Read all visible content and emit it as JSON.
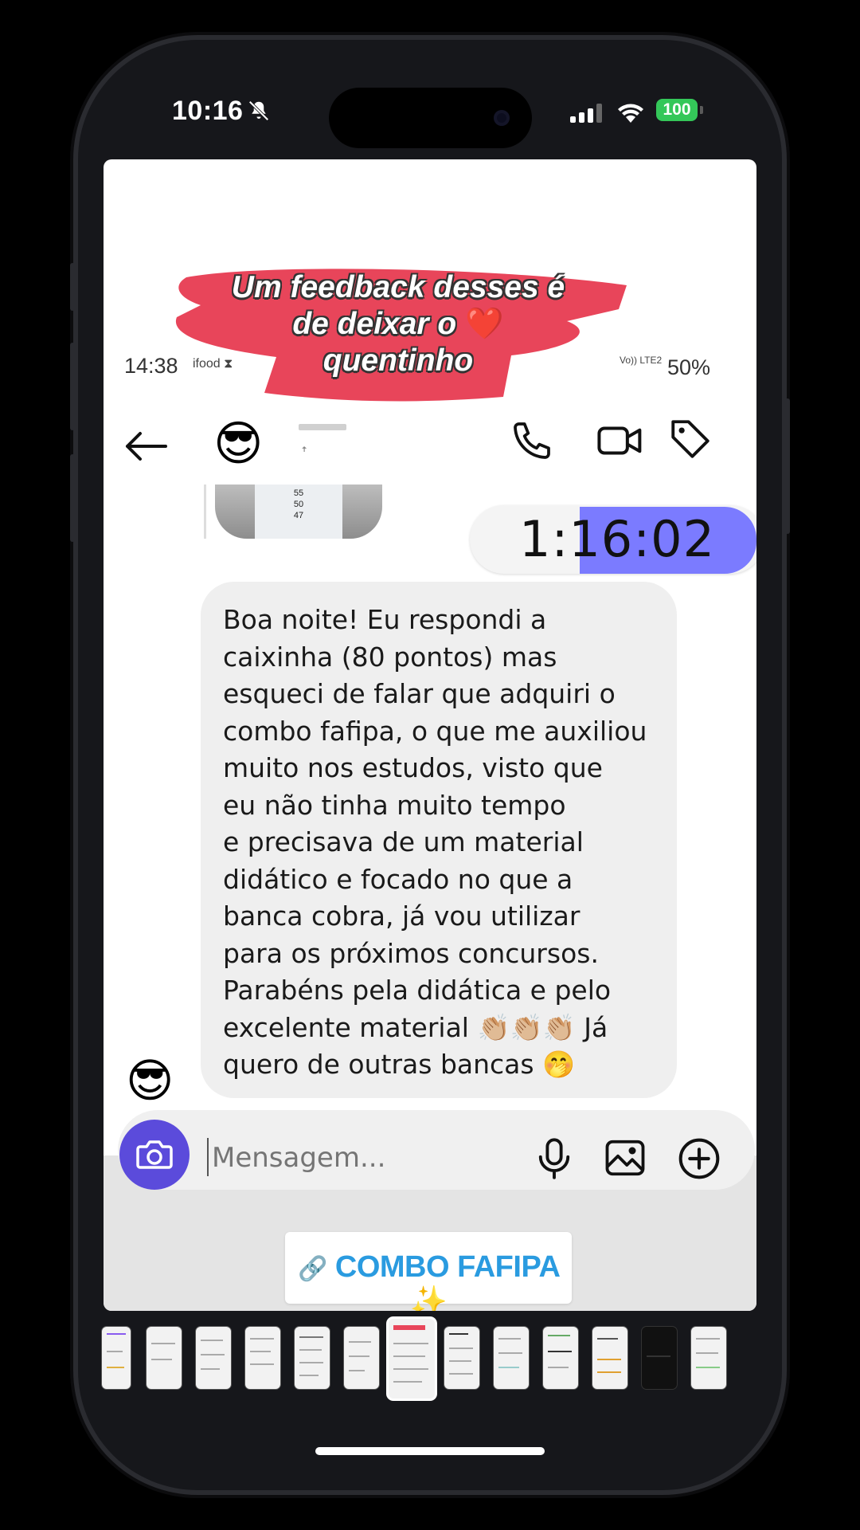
{
  "status_bar": {
    "time": "10:16",
    "battery": "100"
  },
  "story_overlay": {
    "banner_line1": "Um feedback desses é",
    "banner_line2": "de deixar o",
    "banner_heart": "❤️",
    "banner_line3": "quentinho"
  },
  "inner_status_bar": {
    "time": "14:38",
    "signal_text": "Vo)) LTE2",
    "battery": "50%"
  },
  "chat": {
    "header": {
      "contact_avatar": "😎",
      "contact_sub": "ꜛ"
    },
    "timer": "1:16:02",
    "message": "Boa noite! Eu respondi a\ncaixinha (80 pontos) mas\nesqueci de falar que adquiri o\ncombo fafipa, o que me auxiliou\nmuito nos estudos, visto que\neu não tinha muito tempo\ne precisava de um material\ndidático e focado no que a\nbanca cobra, já vou utilizar\npara os próximos concursos.\nParabéns pela didática e pelo\nexcelente material 👏🏼👏🏼👏🏼 Já\nquero de outras bancas 🤭",
    "sender_avatar": "😎",
    "composer": {
      "placeholder": "Mensagem..."
    }
  },
  "link_sticker": {
    "icon": "🔗",
    "label": "COMBO FAFIPA",
    "emoji": "✨"
  },
  "shared_image": {
    "numbers": [
      "55",
      "50",
      "47"
    ]
  },
  "thumbnails_count": 13,
  "icons": [
    "bell-slash-icon",
    "signal-icon",
    "wifi-icon",
    "back-arrow-icon",
    "phone-icon",
    "video-icon",
    "tag-icon",
    "camera-icon",
    "mic-icon",
    "image-icon",
    "plus-circle-icon",
    "link-icon"
  ]
}
